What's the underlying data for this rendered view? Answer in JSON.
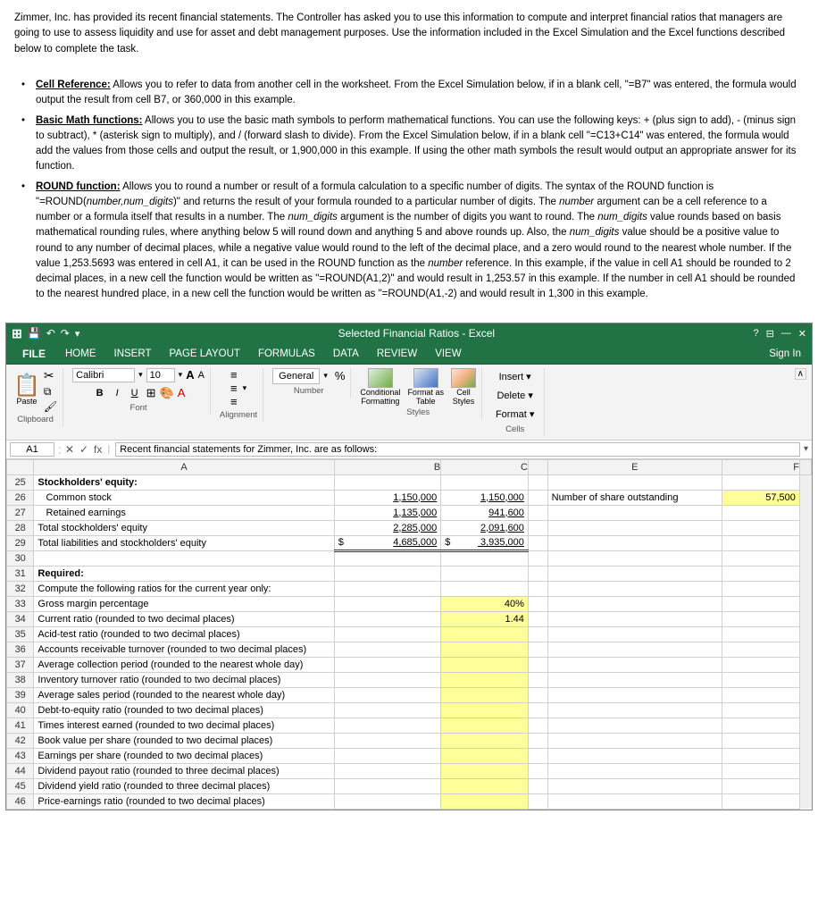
{
  "intro": {
    "paragraph": "Zimmer, Inc. has provided its recent financial statements.  The Controller has asked you to use this information to compute and interpret financial ratios that managers are going to use to assess liquidity and use for asset and debt management purposes.   Use the information included in the Excel Simulation and the Excel functions described below to complete the task.",
    "bullets": [
      {
        "label": "Cell Reference:",
        "text": " Allows you to refer to data from another cell in the worksheet.  From the Excel Simulation below, if in a blank cell, \"=B7\" was entered, the formula would output the result from cell B7, or 360,000 in this example."
      },
      {
        "label": "Basic Math functions:",
        "text": " Allows you to use the basic math symbols to perform mathematical functions.  You can use the following keys:  + (plus sign to add), - (minus sign to subtract), * (asterisk sign to multiply), and / (forward slash to divide).  From the Excel Simulation below, if in a blank cell \"=C13+C14\" was entered, the formula would add the values from those cells and output the result, or 1,900,000 in this example.  If using the other math symbols the result would output an appropriate answer for its function."
      },
      {
        "label": "ROUND function:",
        "text": " Allows you to round a number or result of a formula calculation to a specific number of digits.  The syntax of the ROUND function is \"=ROUND(number,num_digits)\" and returns the result of your formula rounded to a particular number of digits.  The number argument can be a cell reference to a number or a formula itself that results in a number.  The num_digits argument is the number of digits you want to round.  The num_digits value rounds based on basis mathematical rounding rules, where anything below 5 will round down and anything 5 and above rounds up.  Also, the num_digits value should be a positive value to round to any number of decimal places, while a negative value would round to the left of the decimal place, and a zero would round to the nearest whole number.  If the value 1,253.5693 was entered in cell A1, it can be used in the ROUND function as the number reference.  In this example, if the value in cell A1 should be rounded to 2 decimal places, in a new cell the function would be written as \"=ROUND(A1,2)\" and would result in 1,253.57 in this example.  If the number in cell A1 should be rounded to the nearest hundred place, in a new cell the function would be written as \"=ROUND(A1,-2) and would result in 1,300 in this example."
      }
    ]
  },
  "excel": {
    "title": "Selected Financial Ratios - Excel",
    "titlebar_icons": "⊞ ✦",
    "controls": "? ⊟ — ✕",
    "menu": {
      "file": "FILE",
      "items": [
        "HOME",
        "INSERT",
        "PAGE LAYOUT",
        "FORMULAS",
        "DATA",
        "REVIEW",
        "VIEW"
      ],
      "sign_in": "Sign In"
    },
    "ribbon": {
      "paste_label": "Paste",
      "clipboard_label": "Clipboard",
      "font_name": "Calibri",
      "font_size": "10",
      "font_label": "Font",
      "alignment_label": "Alignment",
      "number_label": "Number",
      "conditional_label": "Conditional\nFormatting",
      "format_table_label": "Format as\nTable",
      "cell_styles_label": "Cell\nStyles",
      "cells_label": "Cells",
      "styles_label": "Styles",
      "percent_symbol": "%",
      "bold": "B",
      "italic": "I",
      "underline": "U"
    },
    "formula_bar": {
      "cell_ref": "A1",
      "formula_text": "Recent financial statements for Zimmer, Inc. are as follows:",
      "fx_label": "fx"
    },
    "columns": [
      "",
      "A",
      "B",
      "C",
      "",
      "E",
      "F",
      ""
    ],
    "rows": [
      {
        "num": "25",
        "a": "Stockholders' equity:",
        "b": "",
        "c": "",
        "d": "",
        "e": "",
        "f": "",
        "bold_a": true
      },
      {
        "num": "26",
        "a": "   Common stock",
        "b": "1,150,000",
        "c": "1,150,000",
        "d": "",
        "e": "Number of share outstanding",
        "f": "57,500",
        "f_yellow": true
      },
      {
        "num": "27",
        "a": "   Retained earnings",
        "b": "1,135,000",
        "c": "941,600",
        "d": "",
        "e": "",
        "f": ""
      },
      {
        "num": "28",
        "a": "Total stockholders' equity",
        "b": "2,285,000",
        "c": "2,091,600",
        "d": "",
        "e": "",
        "f": ""
      },
      {
        "num": "29",
        "a": "Total liabilities and stockholders' equity",
        "b": "4,685,000",
        "c": "3,935,000",
        "dollar_b": true,
        "dollar_c": true,
        "d": "",
        "e": "",
        "f": ""
      },
      {
        "num": "30",
        "a": "",
        "b": "",
        "c": "",
        "d": "",
        "e": "",
        "f": ""
      },
      {
        "num": "31",
        "a": "Required:",
        "b": "",
        "c": "",
        "d": "",
        "e": "",
        "f": "",
        "bold_a": true
      },
      {
        "num": "32",
        "a": "Compute the following ratios for the current year only:",
        "b": "",
        "c": "",
        "d": "",
        "e": "",
        "f": ""
      },
      {
        "num": "33",
        "a": "Gross margin percentage",
        "b": "",
        "c": "40%",
        "d": "",
        "e": "",
        "f": "",
        "c_yellow": true
      },
      {
        "num": "34",
        "a": "Current ratio (rounded to two decimal places)",
        "b": "",
        "c": "1.44",
        "d": "",
        "e": "",
        "f": "",
        "c_yellow": true
      },
      {
        "num": "35",
        "a": "Acid-test ratio (rounded to two decimal places)",
        "b": "",
        "c": "",
        "d": "",
        "e": "",
        "f": ""
      },
      {
        "num": "36",
        "a": "Accounts receivable turnover (rounded to two decimal places)",
        "b": "",
        "c": "",
        "d": "",
        "e": "",
        "f": ""
      },
      {
        "num": "37",
        "a": "Average collection period (rounded to the nearest whole day)",
        "b": "",
        "c": "",
        "d": "",
        "e": "",
        "f": ""
      },
      {
        "num": "38",
        "a": "Inventory turnover ratio (rounded to two decimal places)",
        "b": "",
        "c": "",
        "d": "",
        "e": "",
        "f": ""
      },
      {
        "num": "39",
        "a": "Average sales period (rounded to the nearest whole day)",
        "b": "",
        "c": "",
        "d": "",
        "e": "",
        "f": ""
      },
      {
        "num": "40",
        "a": "Debt-to-equity ratio (rounded to two decimal places)",
        "b": "",
        "c": "",
        "d": "",
        "e": "",
        "f": ""
      },
      {
        "num": "41",
        "a": "Times interest earned (rounded to two decimal places)",
        "b": "",
        "c": "",
        "d": "",
        "e": "",
        "f": ""
      },
      {
        "num": "42",
        "a": "Book value per share (rounded to two decimal places)",
        "b": "",
        "c": "",
        "d": "",
        "e": "",
        "f": ""
      },
      {
        "num": "43",
        "a": "Earnings per share (rounded to two decimal places)",
        "b": "",
        "c": "",
        "d": "",
        "e": "",
        "f": ""
      },
      {
        "num": "44",
        "a": "Dividend payout ratio (rounded to three decimal places)",
        "b": "",
        "c": "",
        "d": "",
        "e": "",
        "f": ""
      },
      {
        "num": "45",
        "a": "Dividend yield ratio (rounded to three decimal places)",
        "b": "",
        "c": "",
        "d": "",
        "e": "",
        "f": ""
      },
      {
        "num": "46",
        "a": "Price-earnings ratio (rounded to two decimal places)",
        "b": "",
        "c": "",
        "d": "",
        "e": "",
        "f": ""
      }
    ]
  }
}
